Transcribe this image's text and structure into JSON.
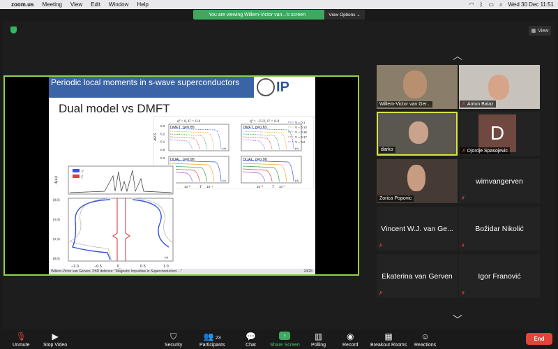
{
  "menubar": {
    "app": "zoom.us",
    "items": [
      "Meeting",
      "View",
      "Edit",
      "Window",
      "Help"
    ],
    "datetime": "Wed 30 Dec  11:51"
  },
  "banner": {
    "text": "You are viewing Willem-Victor van...'s screen",
    "options": "View Options ⌄"
  },
  "view_button": "View",
  "slide": {
    "header": "Periodic local moments in s-wave superconductors",
    "logo_text": "IP",
    "title": "Dual model vs DMFT",
    "footer": "Willem-Victor van Gerven, PhD defence: \"Magnetic Impurities in Superconductors ...\"",
    "page": "24/26"
  },
  "chart_data": [
    {
      "type": "line",
      "title": "",
      "panels": [
        {
          "label": "DMFT, g=0.85",
          "header": "εf = 0, U = 0.4"
        },
        {
          "label": "DMFT, g=0.83",
          "header": "εf = −U/2, U = 0.4"
        },
        {
          "label": "DUAL, g=0.98"
        },
        {
          "label": "DUAL, g=0.98"
        }
      ],
      "ylabel": "ΔSCS",
      "xlabel": "T",
      "yticks": [
        "0.3",
        "0.2",
        "0.1",
        "0.0"
      ],
      "xticks": [
        "10⁻²",
        "10⁻¹"
      ],
      "panel_tags": [
        "(a)",
        "(b)",
        "(c)",
        "(d)"
      ],
      "legend": [
        "V = 0.1",
        "V = 0.14",
        "V = 0.16",
        "V = 0.17",
        "V = 0.2"
      ],
      "colors": [
        "#3a55d8",
        "#f0a030",
        "#2c9a4a",
        "#d83a3a",
        "#9a60d0"
      ]
    },
    {
      "type": "line",
      "ylabel": "A(ω)",
      "xlabel": "ω",
      "legend": [
        "c",
        "f"
      ],
      "colors": [
        "#3a55d8",
        "#e04040"
      ],
      "yticks": [
        "(0,0)",
        "(π,0)",
        "(π,π)",
        "(0,0)"
      ],
      "xticks": [
        "−1.0",
        "−0.5",
        "0",
        "0.5",
        "1.0"
      ],
      "panel_tag": "(d)"
    }
  ],
  "participants": [
    {
      "name": "Willem-Victor van Ger...",
      "muted": false
    },
    {
      "name": "Antun Balaz",
      "muted": true
    },
    {
      "name": "darko",
      "muted": false,
      "active": true
    },
    {
      "name": "Djordje Spasojevic",
      "muted": true,
      "avatar_letter": "D"
    },
    {
      "name": "Zorica Popovic",
      "muted": false
    },
    {
      "name": "wimvangerven",
      "muted": true
    },
    {
      "name": "Vincent W.J. van Ge...",
      "muted": true
    },
    {
      "name": "Božidar Nikolić",
      "muted": true
    },
    {
      "name": "Ekaterina van Gerven",
      "muted": true
    },
    {
      "name": "Igor Franović",
      "muted": true
    }
  ],
  "toolbar": {
    "unmute": "Unmute",
    "stop_video": "Stop Video",
    "security": "Security",
    "participants": "Participants",
    "participants_count": "23",
    "chat": "Chat",
    "share_screen": "Share Screen",
    "polling": "Polling",
    "record": "Record",
    "breakout": "Breakout Rooms",
    "reactions": "Reactions",
    "end": "End"
  }
}
